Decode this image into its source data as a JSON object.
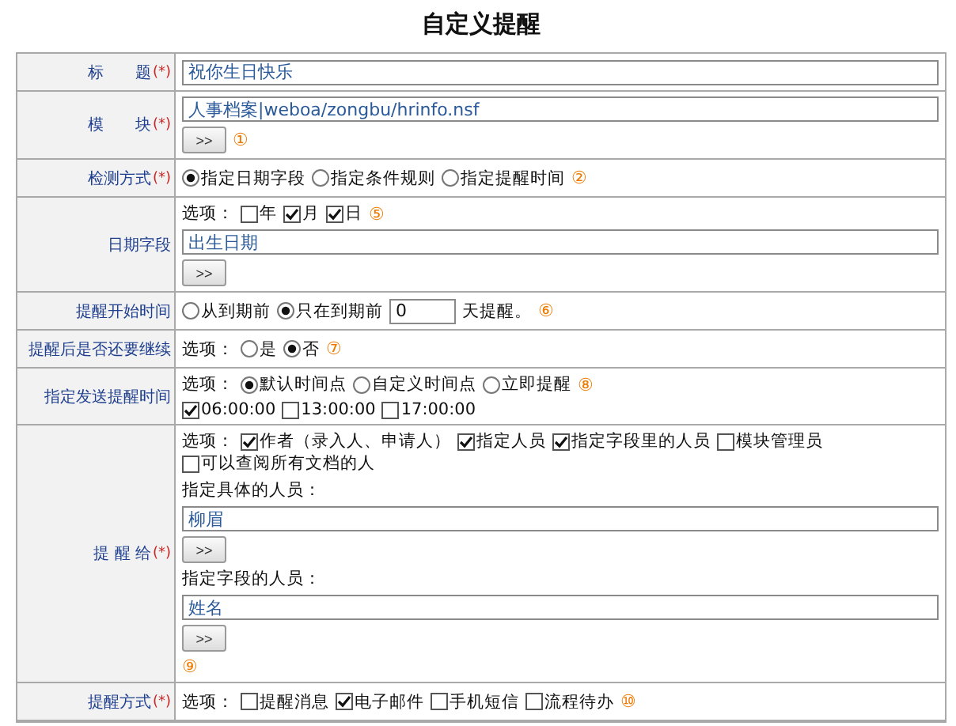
{
  "title": "自定义提醒",
  "rows": [
    {
      "label": "标　　题",
      "required_mark": "(*)",
      "lines": [
        [
          {
            "kind": "input",
            "value": "祝你生日快乐"
          }
        ]
      ]
    },
    {
      "label": "模　　块",
      "required_mark": "(*)",
      "lines": [
        [
          {
            "kind": "input",
            "value": "人事档案|weboa/zongbu/hrinfo.nsf"
          }
        ],
        [
          {
            "kind": "button",
            "label": ">>"
          },
          {
            "kind": "note",
            "text": "①"
          }
        ]
      ]
    },
    {
      "label": "检测方式",
      "required_mark": "(*)",
      "lines": [
        [
          {
            "kind": "radio",
            "label": "指定日期字段",
            "selected": true
          },
          {
            "kind": "radio",
            "label": "指定条件规则",
            "selected": false
          },
          {
            "kind": "radio",
            "label": "指定提醒时间",
            "selected": false
          },
          {
            "kind": "note",
            "text": "②"
          }
        ]
      ]
    },
    {
      "label": "日期字段",
      "lines": [
        [
          {
            "kind": "text",
            "text": "选项："
          },
          {
            "kind": "checkbox",
            "label": "年",
            "checked": false
          },
          {
            "kind": "checkbox",
            "label": "月",
            "checked": true
          },
          {
            "kind": "checkbox",
            "label": "日",
            "checked": true
          },
          {
            "kind": "note",
            "text": "⑤"
          }
        ],
        [
          {
            "kind": "input",
            "value": "出生日期"
          }
        ],
        [
          {
            "kind": "button",
            "label": ">>"
          }
        ]
      ]
    },
    {
      "label": "提醒开始时间",
      "lines": [
        [
          {
            "kind": "radio",
            "label": "从到期前",
            "selected": false
          },
          {
            "kind": "radio",
            "label": "只在到期前",
            "selected": true
          },
          {
            "kind": "number-input",
            "value": "0"
          },
          {
            "kind": "text",
            "text": "天提醒。"
          },
          {
            "kind": "note",
            "text": "⑥"
          }
        ]
      ]
    },
    {
      "label": "提醒后是否还要继续",
      "lines": [
        [
          {
            "kind": "text",
            "text": "选项："
          },
          {
            "kind": "radio",
            "label": "是",
            "selected": false
          },
          {
            "kind": "radio",
            "label": "否",
            "selected": true
          },
          {
            "kind": "note",
            "text": "⑦"
          }
        ]
      ]
    },
    {
      "label": "指定发送提醒时间",
      "lines": [
        [
          {
            "kind": "text",
            "text": "选项："
          },
          {
            "kind": "radio",
            "label": "默认时间点",
            "selected": true
          },
          {
            "kind": "radio",
            "label": "自定义时间点",
            "selected": false
          },
          {
            "kind": "radio",
            "label": "立即提醒",
            "selected": false
          },
          {
            "kind": "note",
            "text": "⑧"
          }
        ],
        [
          {
            "kind": "checkbox",
            "label": "06:00:00",
            "checked": true
          },
          {
            "kind": "checkbox",
            "label": "13:00:00",
            "checked": false
          },
          {
            "kind": "checkbox",
            "label": "17:00:00",
            "checked": false
          }
        ]
      ]
    },
    {
      "label": "提 醒 给",
      "required_mark": "(*)",
      "lines": [
        [
          {
            "kind": "text",
            "text": "选项："
          },
          {
            "kind": "checkbox",
            "label": "作者（录入人、申请人）",
            "checked": true
          },
          {
            "kind": "checkbox",
            "label": "指定人员",
            "checked": true
          },
          {
            "kind": "checkbox",
            "label": "指定字段里的人员",
            "checked": true
          },
          {
            "kind": "checkbox",
            "label": "模块管理员",
            "checked": false
          },
          {
            "kind": "checkbox",
            "label": "可以查阅所有文档的人",
            "checked": false
          }
        ],
        [
          {
            "kind": "text",
            "text": "指定具体的人员："
          }
        ],
        [
          {
            "kind": "input",
            "value": "柳眉"
          }
        ],
        [
          {
            "kind": "button",
            "label": ">>"
          }
        ],
        [
          {
            "kind": "text",
            "text": "指定字段的人员："
          }
        ],
        [
          {
            "kind": "input",
            "value": "姓名"
          }
        ],
        [
          {
            "kind": "button",
            "label": ">>"
          }
        ],
        [
          {
            "kind": "note",
            "text": "⑨"
          }
        ]
      ]
    },
    {
      "label": "提醒方式",
      "required_mark": "(*)",
      "lines": [
        [
          {
            "kind": "text",
            "text": "选项："
          },
          {
            "kind": "checkbox",
            "label": "提醒消息",
            "checked": false
          },
          {
            "kind": "checkbox",
            "label": "电子邮件",
            "checked": true
          },
          {
            "kind": "checkbox",
            "label": "手机短信",
            "checked": false
          },
          {
            "kind": "checkbox",
            "label": "流程待办",
            "checked": false
          },
          {
            "kind": "note",
            "text": "⑩"
          }
        ]
      ]
    }
  ]
}
